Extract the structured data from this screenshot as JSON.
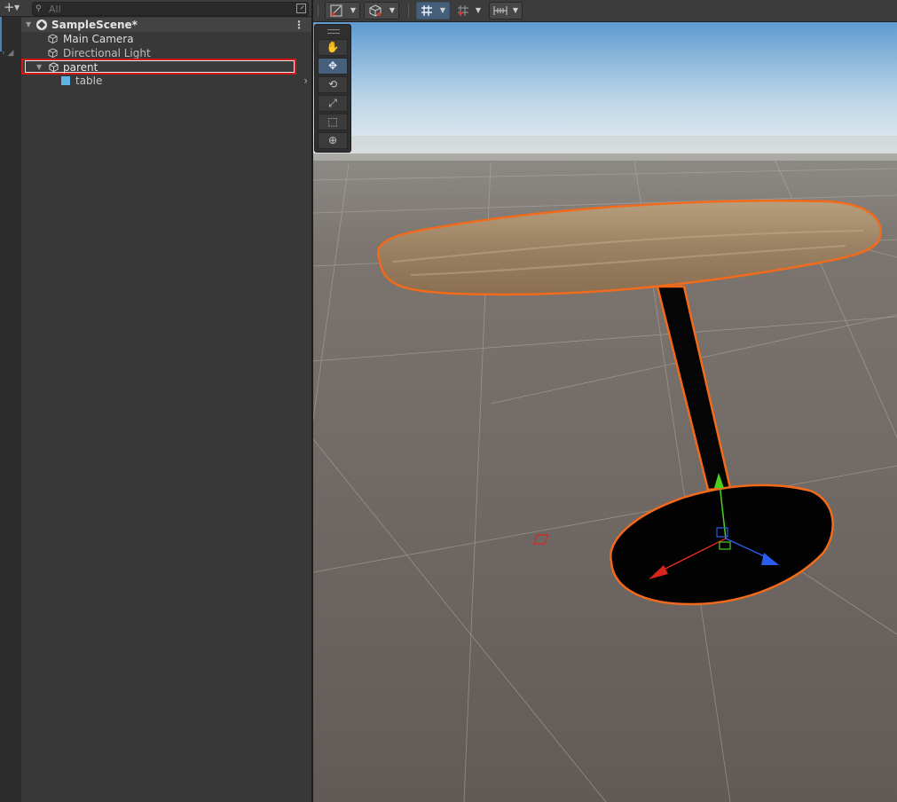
{
  "hierarchy": {
    "search": {
      "placeholder": "All"
    },
    "scene": {
      "name": "SampleScene*"
    },
    "items": [
      {
        "name": "Main Camera",
        "icon": "gameobject-cube-icon"
      },
      {
        "name": "Directional Light",
        "icon": "gameobject-cube-icon"
      },
      {
        "name": "parent",
        "icon": "gameobject-cube-icon",
        "selected": true,
        "expanded": true
      },
      {
        "name": "table",
        "icon": "prefab-cube-icon"
      }
    ]
  },
  "scene_toolbar": {
    "tools": [
      {
        "name": "draw-mode",
        "icon": "draw-mode-icon"
      },
      {
        "name": "render-shading",
        "icon": "shading-cube-icon"
      },
      {
        "name": "grid-snapping",
        "icon": "grid-icon",
        "active": true
      },
      {
        "name": "snap-settings",
        "icon": "snap-grid-icon"
      },
      {
        "name": "increment-snap",
        "icon": "ruler-icon"
      }
    ]
  },
  "tool_palette": [
    {
      "name": "hand-tool",
      "glyph": "✋",
      "active": false
    },
    {
      "name": "move-tool",
      "glyph": "✥",
      "active": true
    },
    {
      "name": "rotate-tool",
      "glyph": "⟲",
      "active": false
    },
    {
      "name": "scale-tool",
      "glyph": "⤢",
      "active": false
    },
    {
      "name": "rect-tool",
      "glyph": "⬚",
      "active": false
    },
    {
      "name": "transform-tool",
      "glyph": "⊕",
      "active": false
    }
  ],
  "colors": {
    "selection_outline": "#f26a1b",
    "highlight_box": "#d01a1a",
    "gizmo_x": "#d8261e",
    "gizmo_y": "#4ad11e",
    "gizmo_z": "#2a5cf0",
    "prefab_icon": "#5fb3e6"
  }
}
